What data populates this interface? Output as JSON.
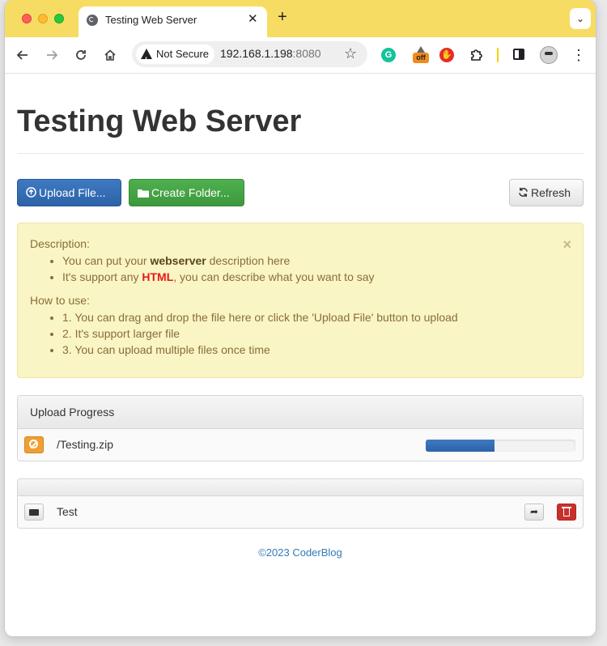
{
  "browser": {
    "tab_title": "Testing Web Server",
    "tab_close": "✕",
    "new_tab": "+",
    "tab_search": "⌄",
    "security_label": "Not Secure",
    "url_host": "192.168.1.198",
    "url_port": ":8080",
    "ext_grammarly": "G",
    "ext_off": "off",
    "ext_block": "✋",
    "menu": "⋮"
  },
  "page": {
    "title": "Testing Web Server",
    "toolbar": {
      "upload_label": "Upload File...",
      "folder_label": "Create Folder...",
      "refresh_label": "Refresh"
    },
    "alert": {
      "close": "×",
      "description_label": "Description:",
      "desc_item1": {
        "before": "You can put your ",
        "highlight": "webserver",
        "after": " description here"
      },
      "desc_item2": {
        "before": "It's support any ",
        "highlight": "HTML",
        "after": ", you can describe what you want to say"
      },
      "howto_label": "How to use:",
      "howto_items": [
        "1. You can drag and drop the file here or click the 'Upload File' button to upload",
        "2. It's support larger file",
        "3. You can upload multiple files once time"
      ]
    },
    "upload_progress": {
      "heading": "Upload Progress",
      "file": "/Testing.zip",
      "progress": 0.46
    },
    "files": {
      "folder_name": "Test"
    },
    "footer": "©2023 CoderBlog"
  },
  "colors": {
    "tab_strip": "#f7dc63",
    "primary": "#337ab7",
    "success": "#4cae4c",
    "danger": "#c9302c",
    "warning": "#ef9f33"
  }
}
